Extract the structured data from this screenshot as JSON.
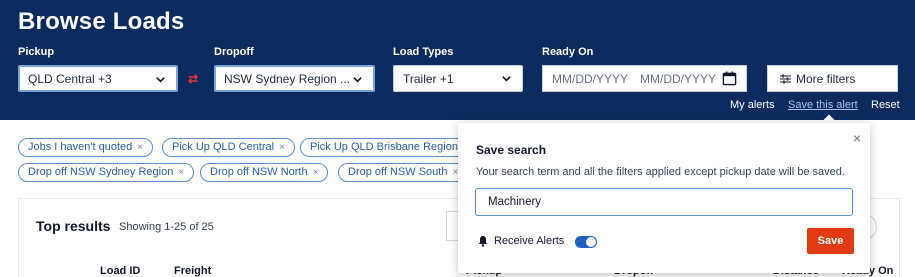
{
  "page": {
    "title": "Browse Loads"
  },
  "filters": {
    "pickup": {
      "label": "Pickup",
      "value": "QLD Central +3"
    },
    "dropoff": {
      "label": "Dropoff",
      "value": "NSW Sydney Region ..."
    },
    "load_types": {
      "label": "Load Types",
      "value": "Trailer +1"
    },
    "ready_on": {
      "label": "Ready On",
      "from_placeholder": "MM/DD/YYYY",
      "to_placeholder": "MM/DD/YYYY"
    },
    "more_filters": "More filters",
    "swap_icon": "swap-arrows-icon"
  },
  "actions": {
    "my_alerts": "My alerts",
    "save_alert": "Save this alert",
    "reset": "Reset"
  },
  "chips": {
    "row1": [
      {
        "label": "Jobs I haven't quoted"
      },
      {
        "label": "Pick Up QLD Central"
      },
      {
        "label": "Pick Up QLD Brisbane Region"
      }
    ],
    "row2": [
      {
        "label": "Drop off NSW Sydney Region"
      },
      {
        "label": "Drop off NSW North"
      },
      {
        "label": "Drop off NSW South"
      }
    ],
    "remove_glyph": "×"
  },
  "results": {
    "title": "Top results",
    "showing": "Showing 1-25 of 25",
    "columns": [
      "Load ID",
      "Freight",
      "Pickup",
      "Dropoff",
      "Distance",
      "Ready On"
    ]
  },
  "save_search": {
    "title": "Save search",
    "description": "Your search term and all the filters applied except pickup date will be saved.",
    "input_value": "Machinery",
    "receive_alerts_label": "Receive Alerts",
    "receive_alerts_on": true,
    "save_label": "Save",
    "close_glyph": "×"
  },
  "colors": {
    "header_bg": "#0b2a5e",
    "accent": "#e23b12",
    "chip_border": "#5b8fd0",
    "toggle_on": "#1f5fbf"
  }
}
